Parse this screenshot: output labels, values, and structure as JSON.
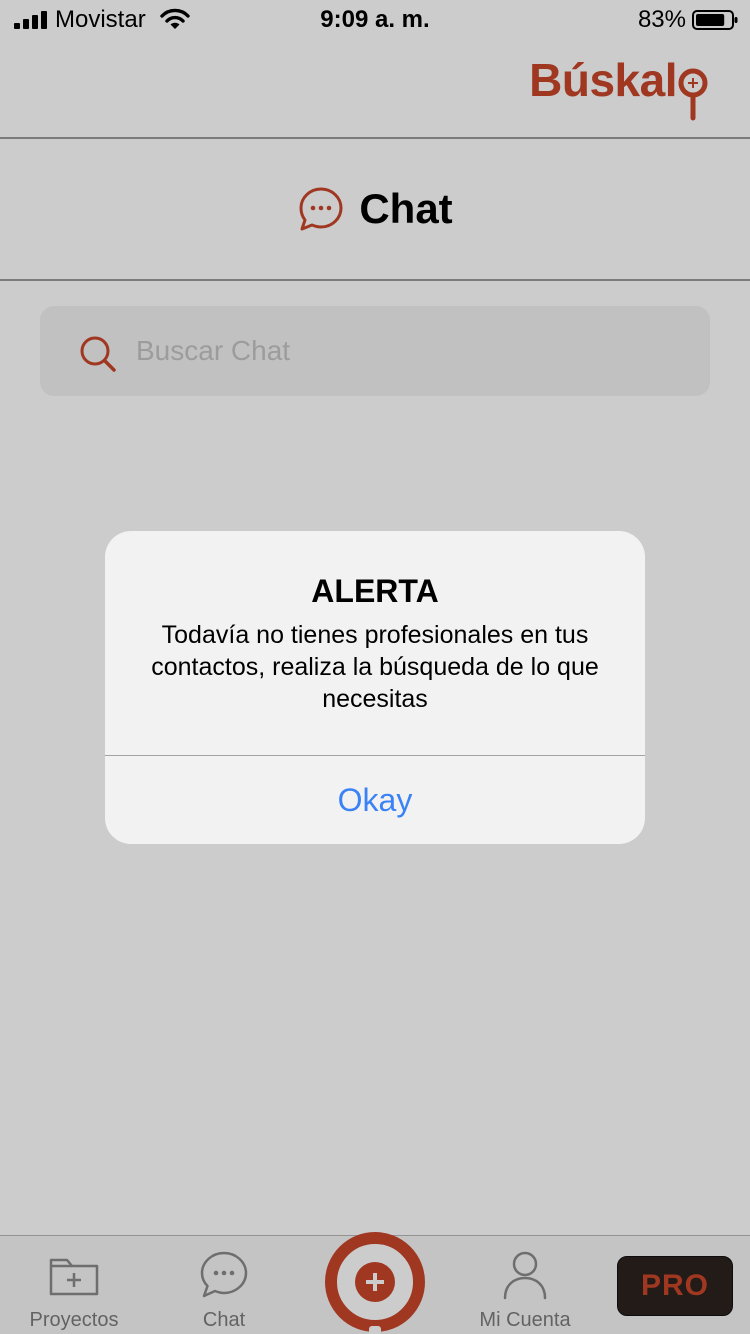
{
  "status_bar": {
    "carrier": "Movistar",
    "time": "9:09 a. m.",
    "battery_percent": "83%",
    "battery_level": 0.83,
    "icons": [
      "signal-icon",
      "wifi-icon",
      "battery-icon"
    ]
  },
  "brand": {
    "logo_text": "Búskal",
    "logo_icon": "magnifier-o-icon"
  },
  "page": {
    "title": "Chat",
    "title_icon": "chat-bubble-icon"
  },
  "search": {
    "placeholder": "Buscar Chat",
    "value": "",
    "icon": "search-icon"
  },
  "tab_bar": {
    "tabs": [
      {
        "label": "Proyectos",
        "icon": "folder-plus-icon"
      },
      {
        "label": "Chat",
        "icon": "chat-bubble-icon"
      },
      {
        "label": "",
        "icon": "add-circle-icon"
      },
      {
        "label": "Mi Cuenta",
        "icon": "user-icon"
      }
    ],
    "pro_label": "PRO"
  },
  "alert": {
    "title": "ALERTA",
    "message": "Todavía no tienes profesionales en tus contactos, realiza la búsqueda de lo que necesitas",
    "button_label": "Okay"
  },
  "colors": {
    "brand": "#c8452a",
    "link": "#3a82f6",
    "pro_bg": "#2c221f",
    "alert_bg": "#f2f2f2"
  }
}
